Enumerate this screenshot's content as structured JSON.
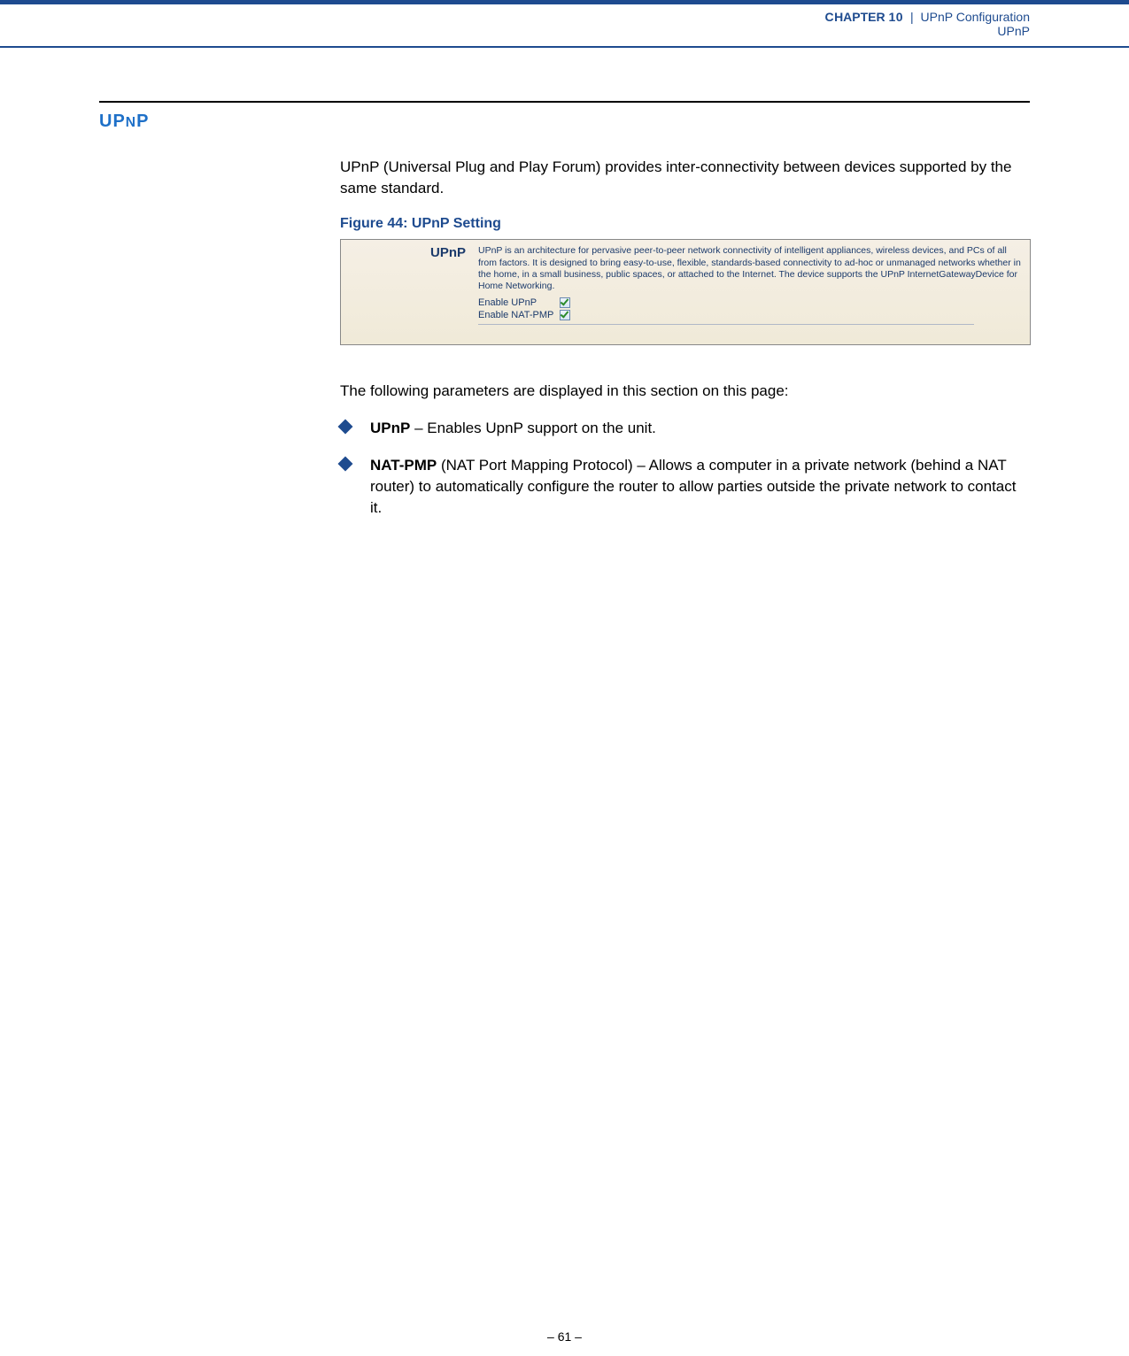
{
  "header": {
    "chapter_prefix": "C",
    "chapter_word_rest": "HAPTER",
    "chapter_number": "10",
    "divider": "|",
    "chapter_title": "UPnP Configuration",
    "section_header": "UPnP"
  },
  "section": {
    "title_pre": "UP",
    "title_small": "N",
    "title_post": "P"
  },
  "intro_para": "UPnP (Universal Plug and Play Forum) provides inter-connectivity between devices supported by the same standard.",
  "figure": {
    "caption_prefix": "Figure 44:  ",
    "caption_title": "UPnP Setting",
    "left_label": "UPnP",
    "description": "UPnP is an architecture for pervasive peer-to-peer network connectivity of intelligent appliances, wireless devices, and PCs of all from factors. It is designed to bring easy-to-use, flexible, standards-based connectivity to ad-hoc or unmanaged networks whether in the home, in a small business, public spaces, or attached to the Internet. The device supports the UPnP InternetGatewayDevice for Home Networking.",
    "options": [
      {
        "label": "Enable UPnP",
        "checked": true
      },
      {
        "label": "Enable NAT-PMP",
        "checked": true
      }
    ]
  },
  "params_intro": "The following parameters are displayed in this section on this page:",
  "bullets": [
    {
      "term": "UPnP",
      "desc": " – Enables UpnP support on the unit."
    },
    {
      "term": "NAT-PMP",
      "desc": " (NAT Port Mapping Protocol) – Allows a computer in a private network (behind a NAT router) to automatically configure the router to allow parties outside the private network to contact it."
    }
  ],
  "footer": {
    "dash_pre": "–  ",
    "page_number": "61",
    "dash_post": "  –"
  }
}
